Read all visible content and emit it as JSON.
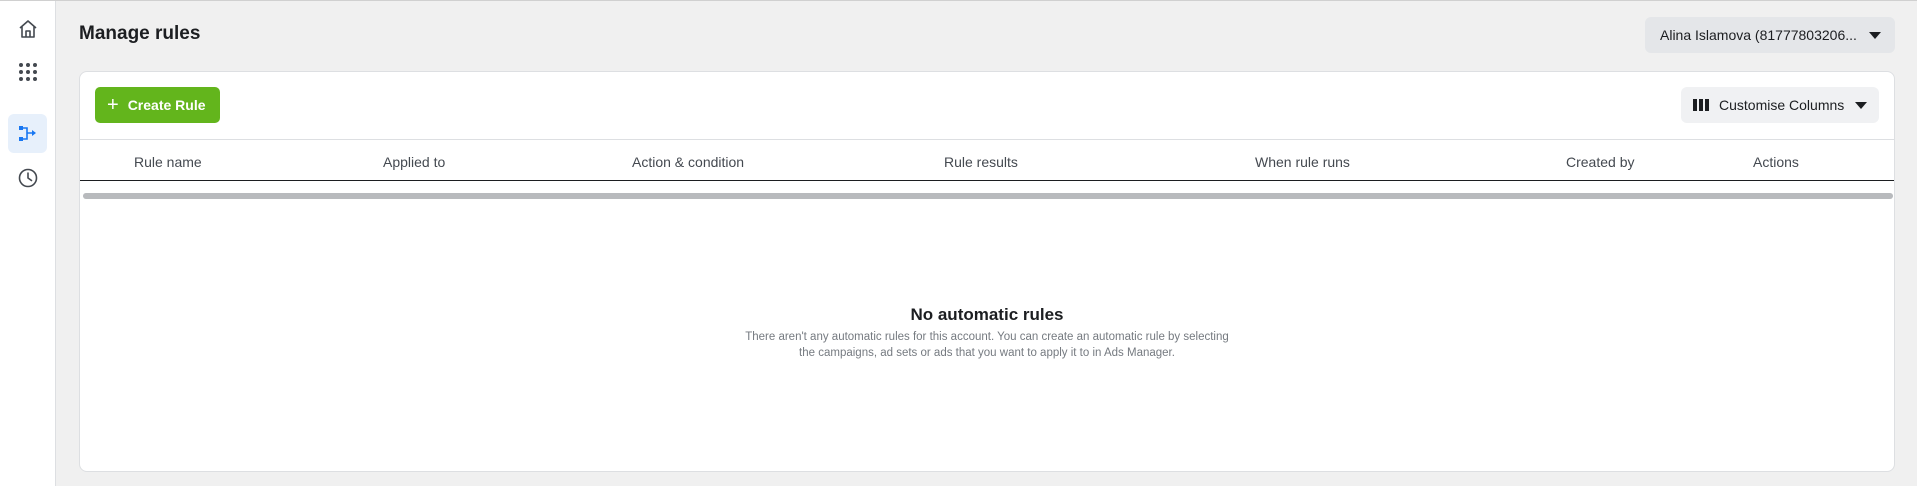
{
  "nav": {
    "items": [
      {
        "icon": "home-icon"
      },
      {
        "icon": "apps-grid-icon"
      },
      {
        "icon": "automated-rules-icon",
        "active": true
      },
      {
        "icon": "history-clock-icon"
      }
    ]
  },
  "header": {
    "title": "Manage rules",
    "account_label": "Alina Islamova (81777803206..."
  },
  "toolbar": {
    "create_label": "Create Rule",
    "create_icon": "plus-icon",
    "columns_label": "Customise Columns",
    "columns_icon": "columns-icon"
  },
  "table": {
    "columns": [
      "Rule name",
      "Applied to",
      "Action & condition",
      "Rule results",
      "When rule runs",
      "Created by",
      "Actions"
    ]
  },
  "empty_state": {
    "title": "No automatic rules",
    "line1": "There aren't any automatic rules for this account. You can create an automatic rule by selecting",
    "line2": "the campaigns, ad sets or ads that you want to apply it to in Ads Manager."
  },
  "colors": {
    "accent_green": "#63b51c",
    "active_nav_bg": "#e7f0fb",
    "active_nav_icon": "#1877f2"
  }
}
